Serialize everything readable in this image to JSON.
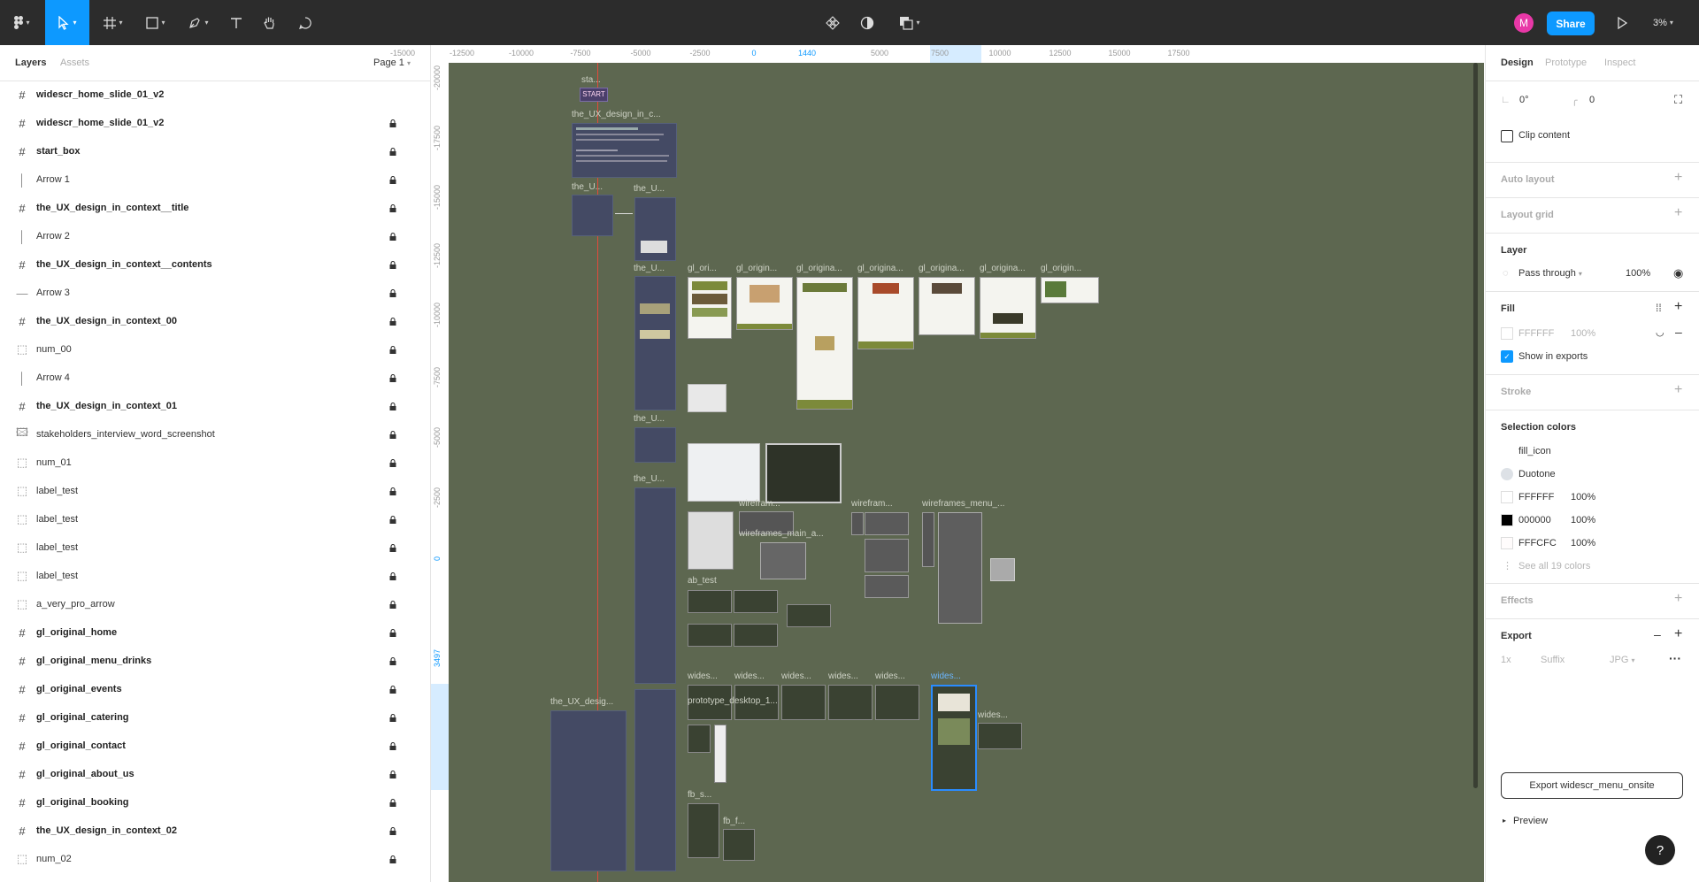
{
  "toolbar": {
    "share_label": "Share",
    "avatar_initial": "M",
    "zoom_label": "3%",
    "accent": "#0d99ff",
    "avatar_color": "#e838a7"
  },
  "left_panel": {
    "tabs": [
      "Layers",
      "Assets"
    ],
    "page_label": "Page 1",
    "layers": [
      {
        "name": "widescr_home_slide_01_v2",
        "type": "frame",
        "locked": false
      },
      {
        "name": "widescr_home_slide_01_v2",
        "type": "frame",
        "locked": true
      },
      {
        "name": "start_box",
        "type": "frame",
        "locked": true
      },
      {
        "name": "Arrow 1",
        "type": "line-v",
        "locked": true
      },
      {
        "name": "the_UX_design_in_context__title",
        "type": "frame",
        "locked": true
      },
      {
        "name": "Arrow 2",
        "type": "line-v",
        "locked": true
      },
      {
        "name": "the_UX_design_in_context__contents",
        "type": "frame",
        "locked": true
      },
      {
        "name": "Arrow 3",
        "type": "line-h",
        "locked": true
      },
      {
        "name": "the_UX_design_in_context_00",
        "type": "frame",
        "locked": true
      },
      {
        "name": "num_00",
        "type": "component",
        "locked": true
      },
      {
        "name": "Arrow 4",
        "type": "line-v",
        "locked": true
      },
      {
        "name": "the_UX_design_in_context_01",
        "type": "frame",
        "locked": true
      },
      {
        "name": "stakeholders_interview_word_screenshot",
        "type": "image",
        "locked": true
      },
      {
        "name": "num_01",
        "type": "component",
        "locked": true
      },
      {
        "name": "label_test",
        "type": "component",
        "locked": true
      },
      {
        "name": "label_test",
        "type": "component",
        "locked": true
      },
      {
        "name": "label_test",
        "type": "component",
        "locked": true
      },
      {
        "name": "label_test",
        "type": "component",
        "locked": true
      },
      {
        "name": "a_very_pro_arrow",
        "type": "component",
        "locked": true
      },
      {
        "name": "gl_original_home",
        "type": "frame",
        "locked": true
      },
      {
        "name": "gl_original_menu_drinks",
        "type": "frame",
        "locked": true
      },
      {
        "name": "gl_original_events",
        "type": "frame",
        "locked": true
      },
      {
        "name": "gl_original_catering",
        "type": "frame",
        "locked": true
      },
      {
        "name": "gl_original_contact",
        "type": "frame",
        "locked": true
      },
      {
        "name": "gl_original_about_us",
        "type": "frame",
        "locked": true
      },
      {
        "name": "gl_original_booking",
        "type": "frame",
        "locked": true
      },
      {
        "name": "the_UX_design_in_context_02",
        "type": "frame",
        "locked": true
      },
      {
        "name": "num_02",
        "type": "component",
        "locked": true
      }
    ]
  },
  "rulers": {
    "top": [
      "-15000",
      "-12500",
      "-10000",
      "-7500",
      "-5000",
      "-2500",
      "0",
      "1440",
      "5000",
      "7500",
      "10000",
      "12500",
      "15000",
      "17500"
    ],
    "left": [
      "-20000",
      "-17500",
      "-15000",
      "-12500",
      "-10000",
      "-7500",
      "-5000",
      "-2500",
      "0",
      "3497"
    ]
  },
  "canvas": {
    "background": "#5d6750",
    "labels": {
      "start_title": "sta...",
      "start_box": "START",
      "title_frame": "the_UX_design_in_c...",
      "t2a": "the_U...",
      "t2b": "the_U...",
      "t3": "the_U...",
      "t4": "the_U...",
      "t5": "the_U...",
      "gl1": "gl_ori...",
      "gl2": "gl_origin...",
      "gl3": "gl_origina...",
      "gl4": "gl_origina...",
      "gl5": "gl_origina...",
      "gl6": "gl_origina...",
      "gl7": "gl_origin...",
      "wf1": "wirefram...",
      "wf2": "wireframes_main_a...",
      "wf3": "wirefram...",
      "wf4": "wireframes_menu_...",
      "ab": "ab_test",
      "w1": "wides...",
      "w2": "wides...",
      "w3": "wides...",
      "w4": "wides...",
      "w5": "wides...",
      "w6": "wides...",
      "w7": "wides...",
      "proto": "prototype_desktop_1...",
      "ux_big": "the_UX_desig...",
      "fb1": "fb_s...",
      "fb2": "fb_f..."
    }
  },
  "right_panel": {
    "tabs": [
      "Design",
      "Prototype",
      "Inspect"
    ],
    "rotation": "0°",
    "corner_radius": "0",
    "clip_content_label": "Clip content",
    "auto_layout_label": "Auto layout",
    "layout_grid_label": "Layout grid",
    "layer_label": "Layer",
    "blend_mode": "Pass through",
    "layer_opacity": "100%",
    "fill_label": "Fill",
    "fill_hex": "FFFFFF",
    "fill_opacity": "100%",
    "show_in_exports_label": "Show in exports",
    "stroke_label": "Stroke",
    "selection_colors_label": "Selection colors",
    "selection_colors": [
      {
        "name": "fill_icon",
        "opacity": "",
        "color": "#ffffff"
      },
      {
        "name": "Duotone",
        "opacity": "",
        "color": "#dde1e6"
      },
      {
        "name": "FFFFFF",
        "opacity": "100%",
        "color": "#ffffff"
      },
      {
        "name": "000000",
        "opacity": "100%",
        "color": "#000000"
      },
      {
        "name": "FFFCFC",
        "opacity": "100%",
        "color": "#fffcfc"
      }
    ],
    "see_all_colors": "See all 19 colors",
    "effects_label": "Effects",
    "export_label": "Export",
    "export_scale": "1x",
    "export_suffix_placeholder": "Suffix",
    "export_format": "JPG",
    "export_button": "Export widescr_menu_onsite",
    "preview_label": "Preview"
  },
  "help_label": "?"
}
